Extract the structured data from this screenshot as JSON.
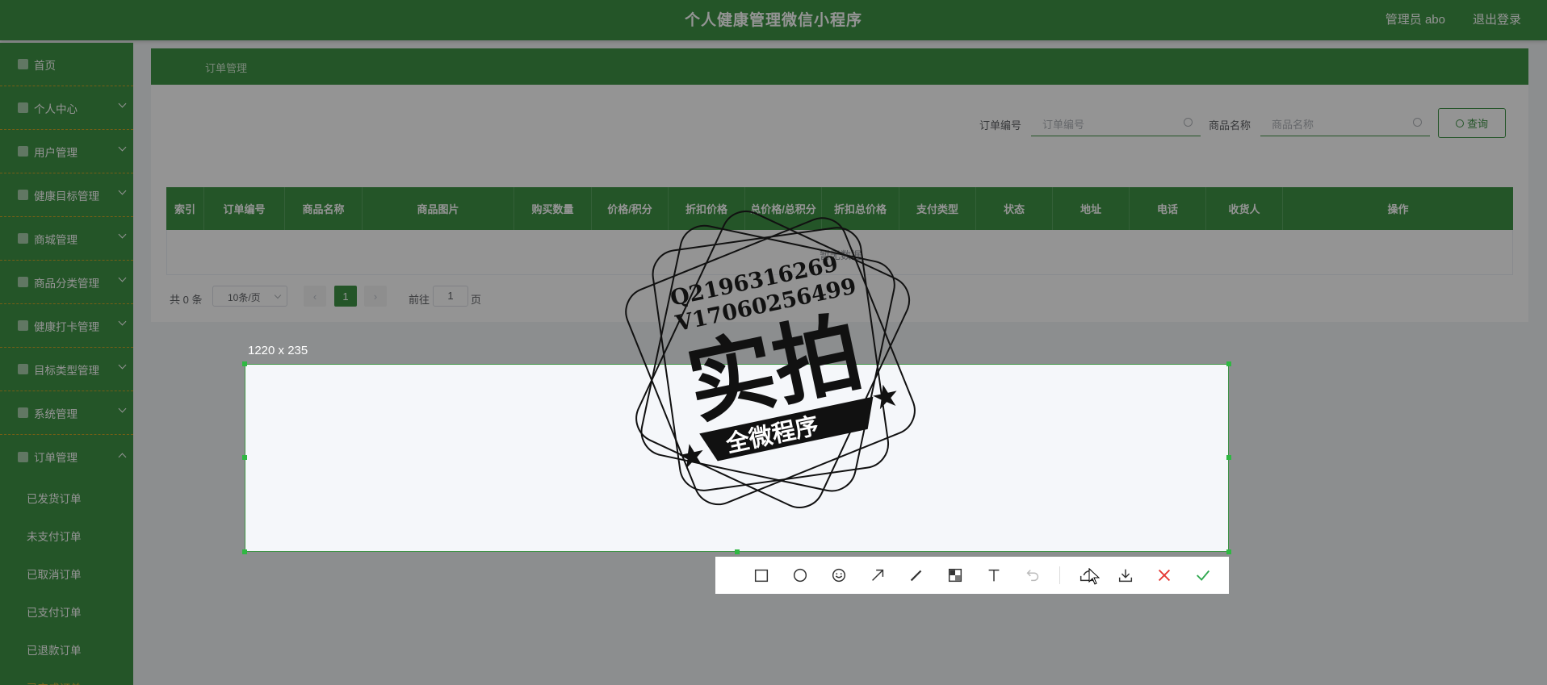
{
  "header": {
    "title": "个人健康管理微信小程序",
    "user": "管理员 abo",
    "logout": "退出登录"
  },
  "sidebar": {
    "items": [
      {
        "label": "首页",
        "arrow": false
      },
      {
        "label": "个人中心",
        "arrow": true
      },
      {
        "label": "用户管理",
        "arrow": true
      },
      {
        "label": "健康目标管理",
        "arrow": true
      },
      {
        "label": "商城管理",
        "arrow": true
      },
      {
        "label": "商品分类管理",
        "arrow": true
      },
      {
        "label": "健康打卡管理",
        "arrow": true
      },
      {
        "label": "目标类型管理",
        "arrow": true
      },
      {
        "label": "系统管理",
        "arrow": true
      },
      {
        "label": "订单管理",
        "arrow": true,
        "expanded": true
      }
    ],
    "subitems": [
      {
        "label": "已发货订单"
      },
      {
        "label": "未支付订单"
      },
      {
        "label": "已取消订单"
      },
      {
        "label": "已支付订单"
      },
      {
        "label": "已退款订单"
      },
      {
        "label": "已完成订单",
        "active": true
      }
    ]
  },
  "breadcrumb": "订单管理",
  "search": {
    "order_no_label": "订单编号",
    "order_no_placeholder": "订单编号",
    "product_name_label": "商品名称",
    "product_name_placeholder": "商品名称",
    "query_button": "查询"
  },
  "table": {
    "columns": [
      "索引",
      "订单编号",
      "商品名称",
      "商品图片",
      "购买数量",
      "价格/积分",
      "折扣价格",
      "总价格/总积分",
      "折扣总价格",
      "支付类型",
      "状态",
      "地址",
      "电话",
      "收货人",
      "操作"
    ],
    "empty_text": "暂无数据"
  },
  "pagination": {
    "total": "共 0 条",
    "page_size": "10条/页",
    "prev": "‹",
    "current_page": "1",
    "next": "›",
    "goto_prefix": "前往",
    "goto_value": "1",
    "goto_suffix": "页"
  },
  "screenshot_tool": {
    "size_label": "1220 x 235",
    "tools": [
      "rectangle-icon",
      "ellipse-icon",
      "emoji-icon",
      "arrow-icon",
      "pen-icon",
      "mosaic-icon",
      "text-icon",
      "undo-icon",
      "share-icon",
      "download-icon",
      "close-icon",
      "confirm-icon"
    ]
  },
  "watermark": {
    "line1": "Q2196316269",
    "line2": "V17060256499",
    "big_text": "实拍",
    "banner_text": "全微程序"
  },
  "colors": {
    "primary": "#3f9346",
    "accent": "#e6b93a",
    "cancel": "#e53935",
    "confirm": "#2fa84f"
  }
}
